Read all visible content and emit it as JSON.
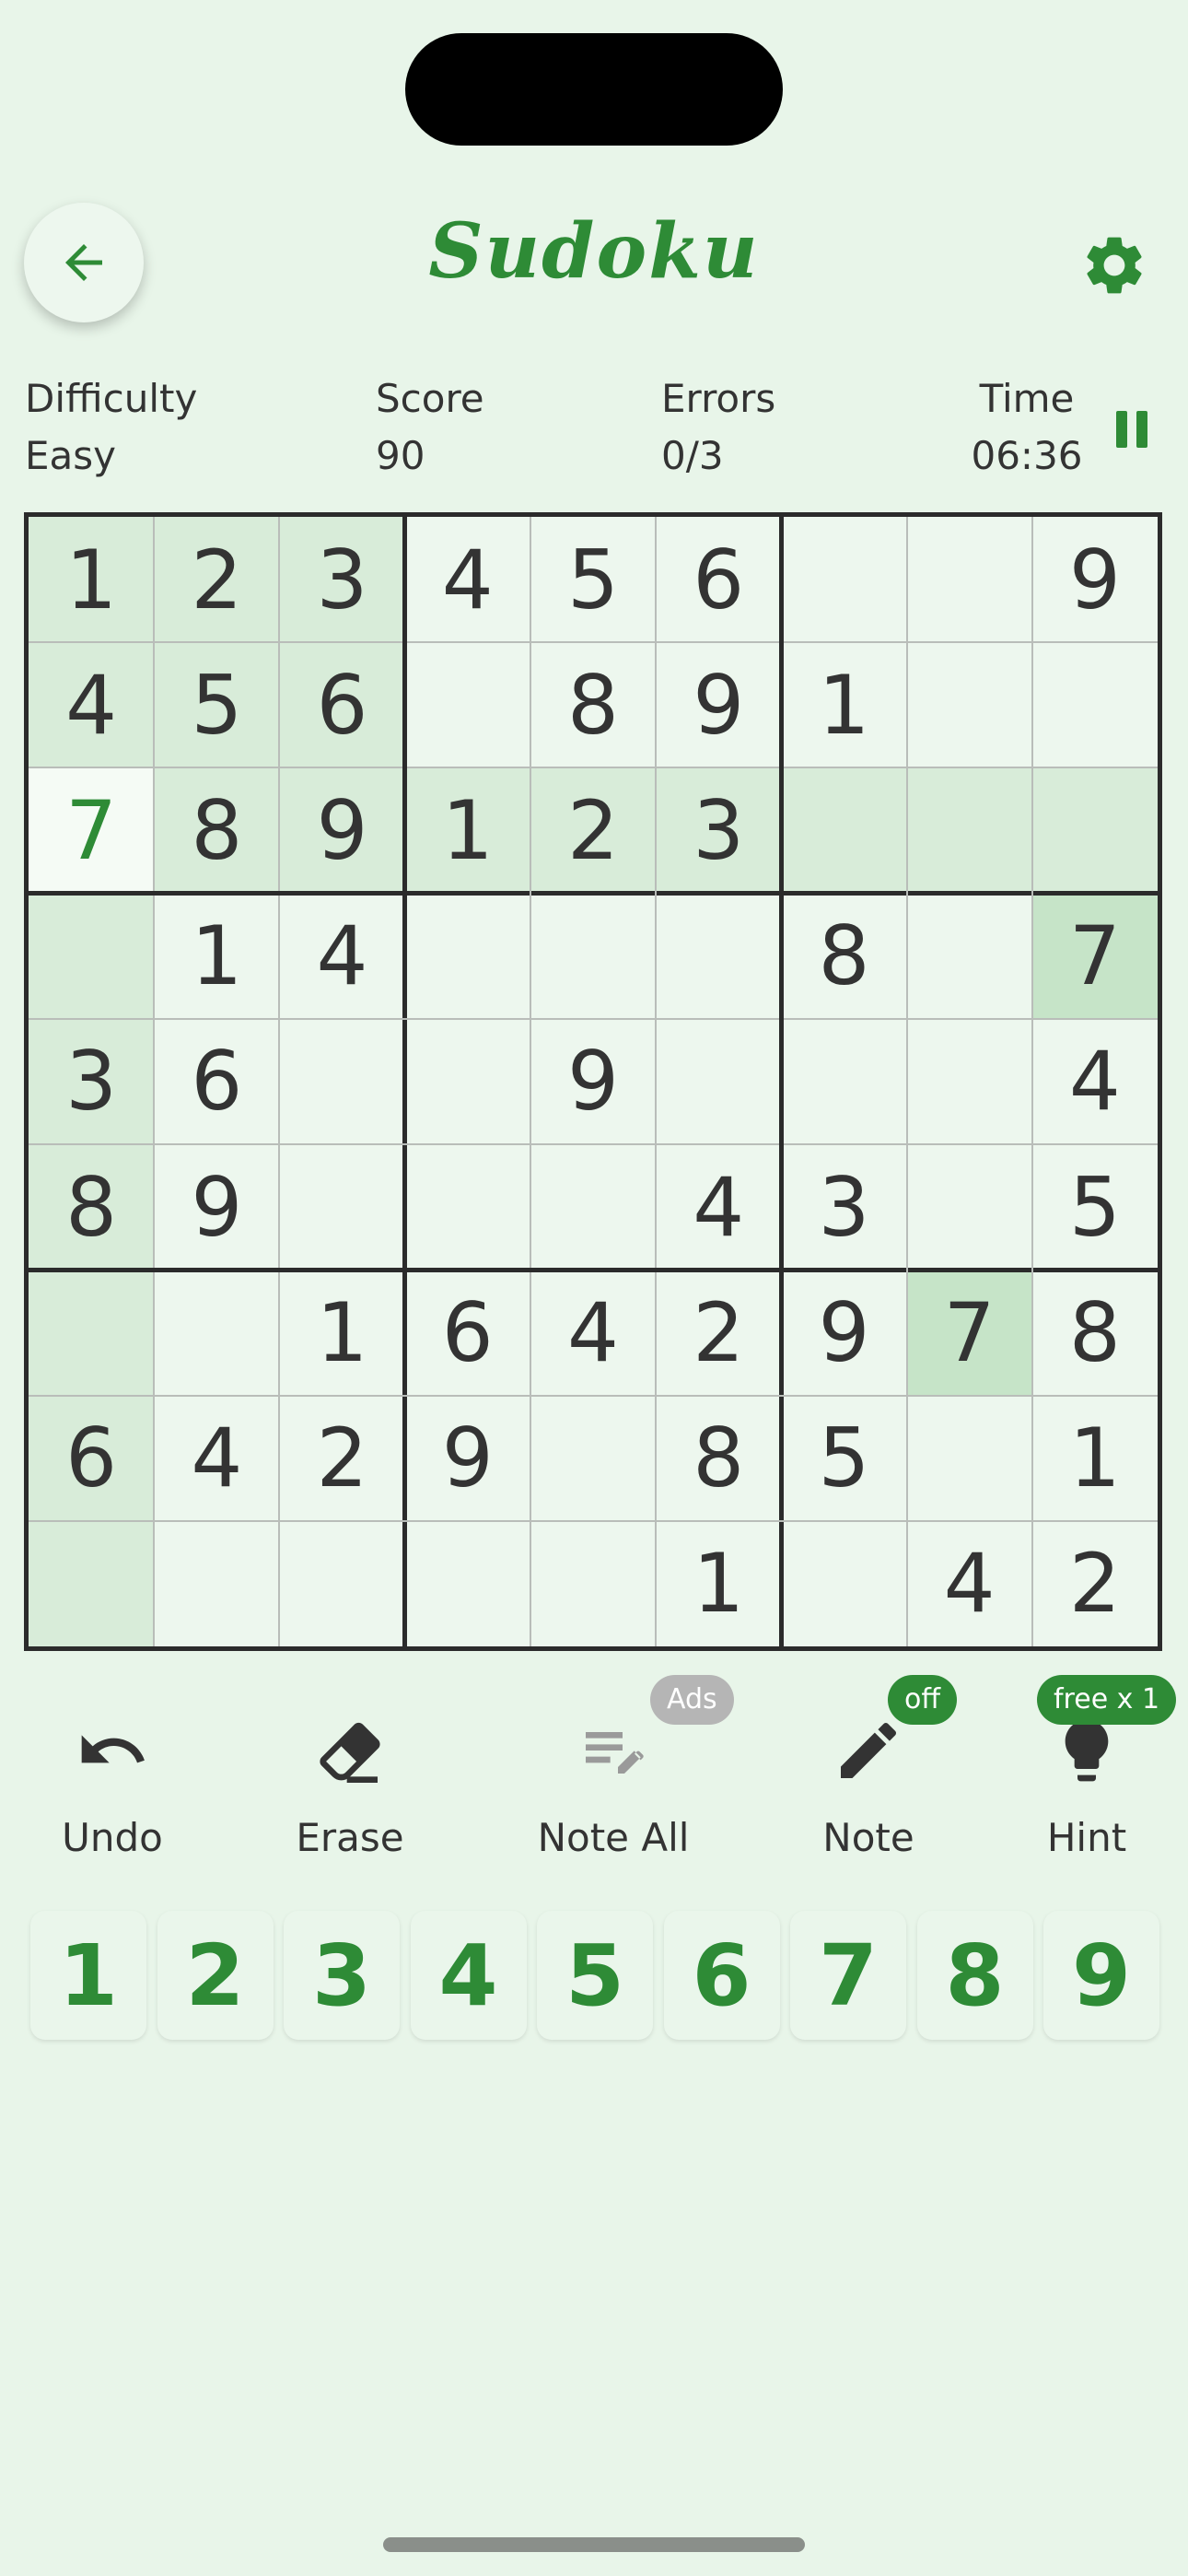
{
  "header": {
    "title": "Sudoku"
  },
  "stats": {
    "difficulty_label": "Difficulty",
    "difficulty_value": "Easy",
    "score_label": "Score",
    "score_value": "90",
    "errors_label": "Errors",
    "errors_value": "0/3",
    "time_label": "Time",
    "time_value": "06:36"
  },
  "board": {
    "rows": [
      [
        "1",
        "2",
        "3",
        "4",
        "5",
        "6",
        "",
        "",
        "9"
      ],
      [
        "4",
        "5",
        "6",
        "",
        "8",
        "9",
        "1",
        "",
        ""
      ],
      [
        "7",
        "8",
        "9",
        "1",
        "2",
        "3",
        "",
        "",
        ""
      ],
      [
        "",
        "1",
        "4",
        "",
        "",
        "",
        "8",
        "",
        "7"
      ],
      [
        "3",
        "6",
        "",
        "",
        "9",
        "",
        "",
        "",
        "4"
      ],
      [
        "8",
        "9",
        "",
        "",
        "",
        "4",
        "3",
        "",
        "5"
      ],
      [
        "",
        "",
        "1",
        "6",
        "4",
        "2",
        "9",
        "7",
        "8"
      ],
      [
        "6",
        "4",
        "2",
        "9",
        "",
        "8",
        "5",
        "",
        "1"
      ],
      [
        "",
        "",
        "",
        "",
        "",
        "1",
        "",
        "4",
        "2"
      ]
    ],
    "selected": {
      "row": 2,
      "col": 0
    },
    "same_value_cells": [
      [
        3,
        8
      ],
      [
        6,
        7
      ]
    ],
    "colors": {
      "cell_bg": "#edf7ee",
      "highlight_bg": "#d8ecd9",
      "same_value_bg": "#c6e4c8",
      "selected_bg": "#f5fbf5",
      "user_digit": "#2e8b36",
      "given_digit": "#333333"
    }
  },
  "toolbar": {
    "undo_label": "Undo",
    "erase_label": "Erase",
    "note_all_label": "Note All",
    "note_all_badge": "Ads",
    "note_label": "Note",
    "note_badge": "off",
    "hint_label": "Hint",
    "hint_badge": "free x 1"
  },
  "numpad": [
    "1",
    "2",
    "3",
    "4",
    "5",
    "6",
    "7",
    "8",
    "9"
  ],
  "accent_color": "#2e8b36"
}
